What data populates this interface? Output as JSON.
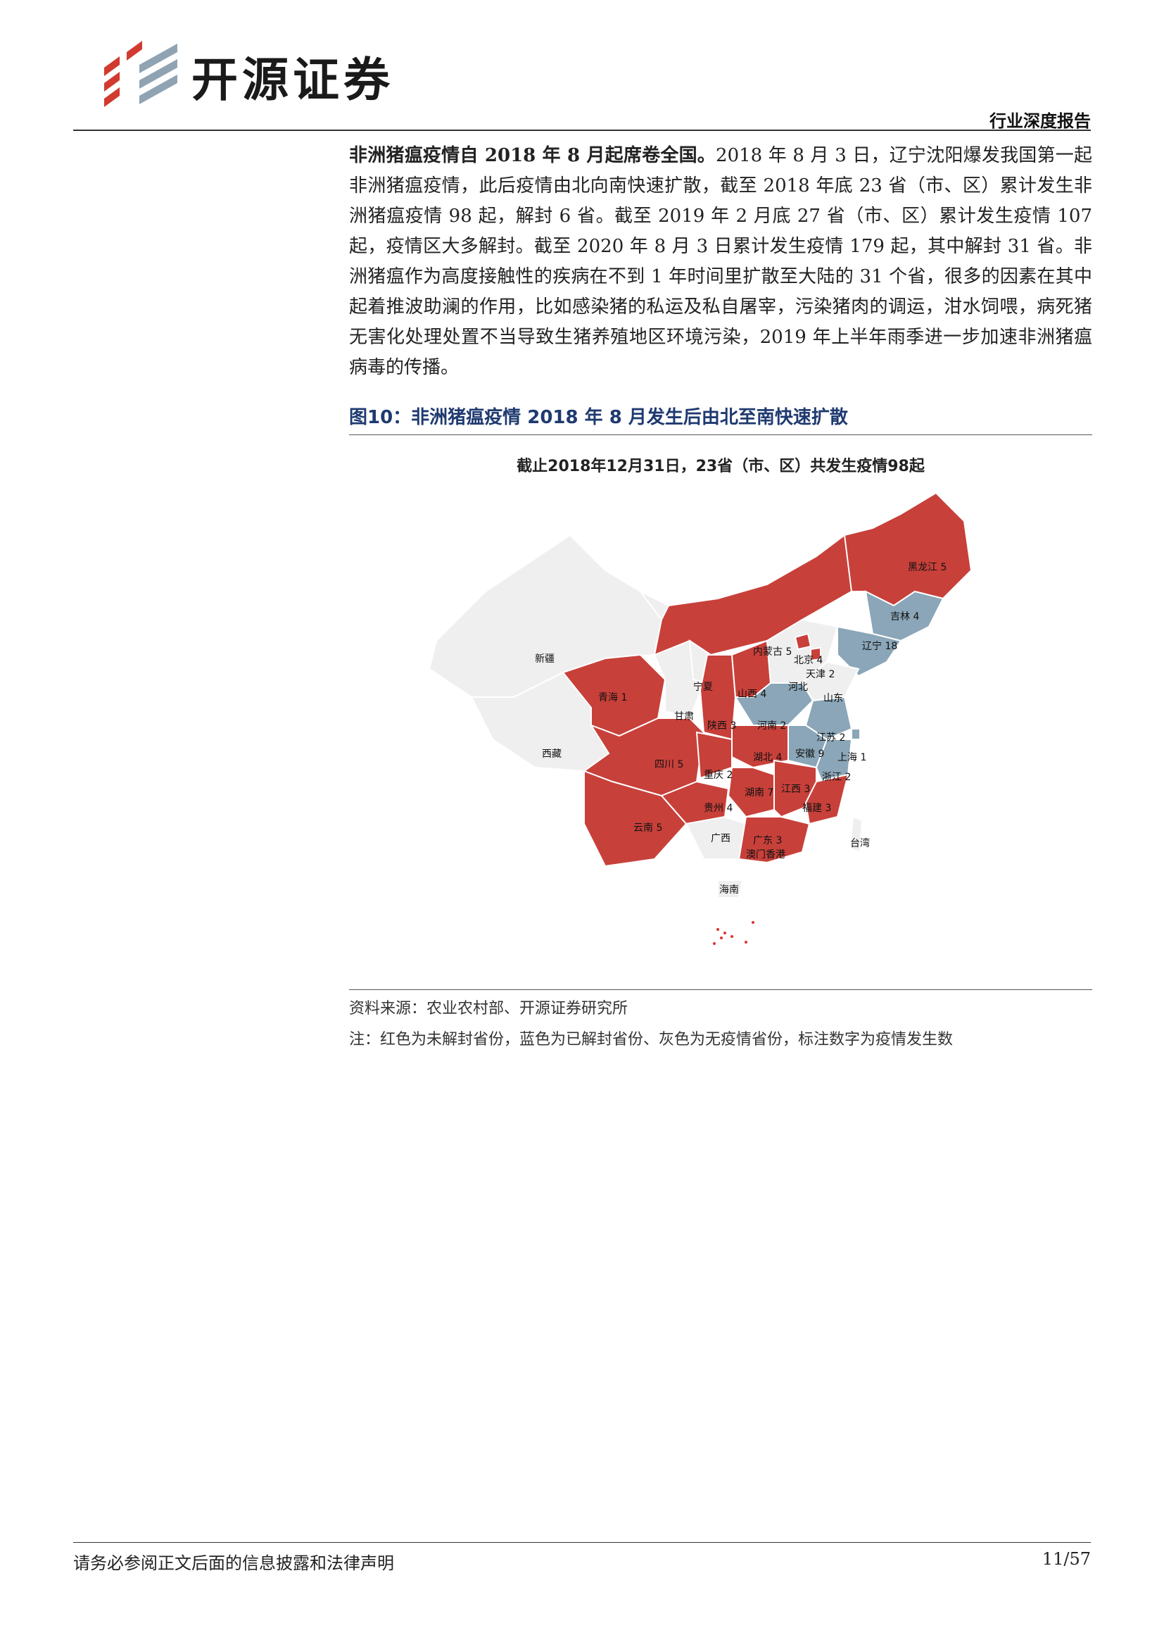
{
  "header": {
    "brand": "开源证券",
    "report_type": "行业深度报告"
  },
  "body": {
    "lead": "非洲猪瘟疫情自 2018 年 8 月起席卷全国。",
    "text": "2018 年 8 月 3 日，辽宁沈阳爆发我国第一起非洲猪瘟疫情，此后疫情由北向南快速扩散，截至 2018 年底 23 省（市、区）累计发生非洲猪瘟疫情 98 起，解封 6 省。截至 2019 年 2 月底 27 省（市、区）累计发生疫情 107 起，疫情区大多解封。截至 2020 年 8 月 3 日累计发生疫情 179 起，其中解封 31 省。非洲猪瘟作为高度接触性的疾病在不到 1 年时间里扩散至大陆的 31 个省，很多的因素在其中起着推波助澜的作用，比如感染猪的私运及私自屠宰，污染猪肉的调运，泔水饲喂，病死猪无害化处理处置不当导致生猪养殖地区环境污染，2019 年上半年雨季进一步加速非洲猪瘟病毒的传播。"
  },
  "figure": {
    "title": "图10：非洲猪瘟疫情 2018 年 8 月发生后由北至南快速扩散",
    "caption": "截止2018年12月31日，23省（市、区）共发生疫情98起",
    "colors": {
      "unlifted": "#c8403a",
      "lifted": "#8aa6b8",
      "none": "#efefef"
    },
    "source": "资料来源：农业农村部、开源证券研究所",
    "note": "注：红色为未解封省份，蓝色为已解封省份、灰色为无疫情省份，标注数字为疫情发生数"
  },
  "map_labels": {
    "heilongjiang": "黑龙江 5",
    "jilin": "吉林 4",
    "liaoning": "辽宁 18",
    "neimenggu": "内蒙古 5",
    "beijing": "北京 4",
    "tianjin": "天津 2",
    "hebei": "河北",
    "shanxi": "山西 4",
    "shandong": "山东",
    "xinjiang": "新疆",
    "qinghai": "青海 1",
    "ningxia": "宁夏",
    "gansu": "甘肃",
    "shaanxi": "陕西 3",
    "henan": "河南 2",
    "jiangsu": "江苏 2",
    "anhui": "安徽 9",
    "shanghai": "上海 1",
    "xizang": "西藏",
    "sichuan": "四川 5",
    "chongqing": "重庆 2",
    "hubei": "湖北 4",
    "zhejiang": "浙江 2",
    "hunan": "湖南 7",
    "jiangxi": "江西 3",
    "guizhou": "贵州 4",
    "fujian": "福建 3",
    "yunnan": "云南 5",
    "guangxi": "广西",
    "guangdong": "广东 3",
    "taiwan": "台湾",
    "aomen_xianggang": "澳门香港",
    "hainan": "海南"
  },
  "footer": {
    "disclaimer": "请务必参阅正文后面的信息披露和法律声明",
    "page": "11/57"
  }
}
